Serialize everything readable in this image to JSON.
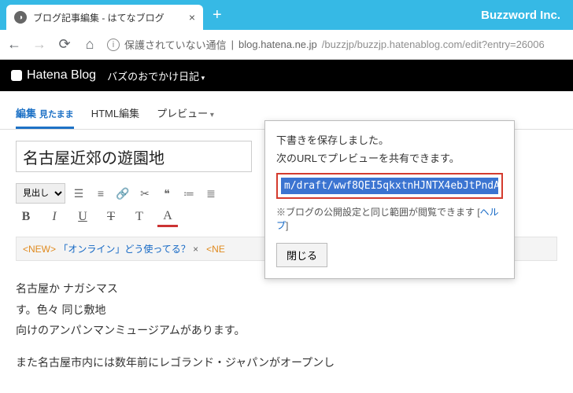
{
  "browser": {
    "tab_title": "ブログ記事編集 - はてなブログ",
    "brand": "Buzzword Inc.",
    "insecure_label": "保護されていない通信",
    "url_host": "blog.hatena.ne.jp",
    "url_path": "/buzzjp/buzzjp.hatenablog.com/edit?entry=26006"
  },
  "header": {
    "logo_text": "Hatena Blog",
    "blog_name": "バズのおでかけ日記"
  },
  "tabs": {
    "edit": "編集",
    "edit_sub": "見たまま",
    "html": "HTML編集",
    "preview": "プレビュー"
  },
  "post": {
    "title": "名古屋近郊の遊園地",
    "heading_select": "見出し",
    "notice_new": "<NEW>",
    "notice_link": "「オンライン」どう使ってる？",
    "notice_close": "×",
    "notice_tail": "<NE",
    "body_p1": "名古屋か                                                                               ナガシマス",
    "body_p2": "す。色々                                                                               同じ敷地",
    "body_p3": "向けのアンパンマンミュージアムがあります。",
    "body_p4": "また名古屋市内には数年前にレゴランド・ジャパンがオープンし"
  },
  "popup": {
    "line1": "下書きを保存しました。",
    "line2": "次のURLでプレビューを共有できます。",
    "url": "m/draft/wwf8QEI5qkxtnHJNTX4ebJtPndA",
    "note_pre": "※ブログの公開設定と同じ範囲が閲覧できます [",
    "note_link": "ヘルプ",
    "note_post": "]",
    "close": "閉じる"
  },
  "toolbar": {
    "bold": "B",
    "italic": "I",
    "underline": "U",
    "strike": "T",
    "size": "T",
    "color": "A"
  }
}
